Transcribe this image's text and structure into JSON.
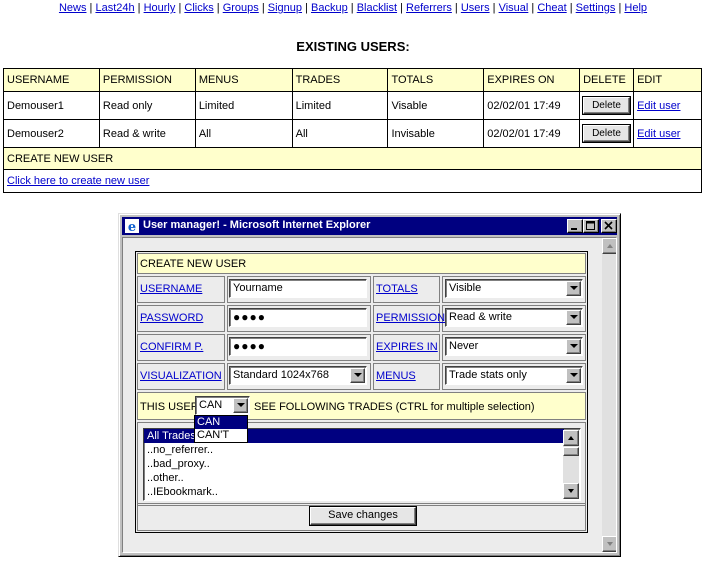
{
  "nav": [
    "News",
    "Last24h",
    "Hourly",
    "Clicks",
    "Groups",
    "Signup",
    "Backup",
    "Blacklist",
    "Referrers",
    "Users",
    "Visual",
    "Cheat",
    "Settings",
    "Help"
  ],
  "page_title": "EXISTING USERS:",
  "users_table": {
    "headers": [
      "USERNAME",
      "PERMISSION",
      "MENUS",
      "TRADES",
      "TOTALS",
      "EXPIRES ON",
      "DELETE",
      "EDIT"
    ],
    "rows": [
      {
        "username": "Demouser1",
        "permission": "Read only",
        "menus": "Limited",
        "trades": "Limited",
        "totals": "Visable",
        "expires": "02/02/01 17:49",
        "delete": "Delete",
        "edit": "Edit user"
      },
      {
        "username": "Demouser2",
        "permission": "Read & write",
        "menus": "All",
        "trades": "All",
        "totals": "Invisable",
        "expires": "02/02/01 17:49",
        "delete": "Delete",
        "edit": "Edit user"
      }
    ],
    "create_header": "CREATE NEW USER",
    "create_link": "Click here to create new user"
  },
  "window": {
    "title": "User manager! - Microsoft Internet Explorer",
    "form": {
      "header": "CREATE NEW USER",
      "username_label": "USERNAME",
      "username_value": "Yourname",
      "password_label": "PASSWORD",
      "password_value": "●●●●",
      "confirm_label": "CONFIRM P.",
      "confirm_value": "●●●●",
      "visualization_label": "VISUALIZATION",
      "visualization_value": "Standard 1024x768",
      "totals_label": "TOTALS",
      "totals_value": "Visible",
      "permission_label": "PERMISSION",
      "permission_value": "Read & write",
      "expires_label": "EXPIRES IN",
      "expires_value": "Never",
      "menus_label": "MENUS",
      "menus_value": "Trade stats only",
      "this_user_label": "THIS USER",
      "can_value": "CAN",
      "can_options": [
        "CAN",
        "CAN'T"
      ],
      "trades_note": "SEE FOLLOWING TRADES (CTRL for multiple selection)",
      "trades": [
        "All Trades",
        "..no_referrer..",
        "..bad_proxy..",
        "..other..",
        "..IEbookmark.."
      ],
      "save_label": "Save changes"
    }
  }
}
